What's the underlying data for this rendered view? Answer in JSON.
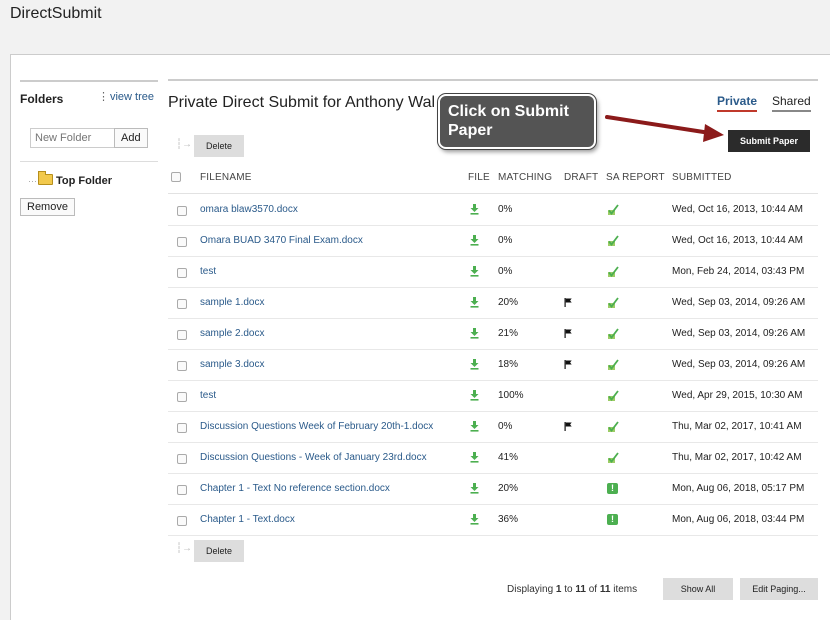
{
  "app": {
    "title": "DirectSubmit"
  },
  "sidebar": {
    "heading": "Folders",
    "view_tree": "view tree",
    "new_folder_placeholder": "New Folder",
    "add_label": "Add",
    "top_folder": "Top Folder",
    "remove_label": "Remove"
  },
  "main": {
    "title": "Private Direct Submit for Anthony Wal",
    "tabs": {
      "private": "Private",
      "shared": "Shared"
    },
    "submit_label": "Submit Paper",
    "delete_label": "Delete",
    "columns": {
      "filename": "FILENAME",
      "file": "FILE",
      "matching": "MATCHING",
      "draft": "DRAFT",
      "sa_report": "SA REPORT",
      "submitted": "SUBMITTED"
    },
    "rows": [
      {
        "filename": "omara blaw3570.docx",
        "matching": "0%",
        "draft": false,
        "sa": "ok",
        "submitted": "Wed, Oct 16, 2013, 10:44 AM"
      },
      {
        "filename": "Omara BUAD 3470 Final Exam.docx",
        "matching": "0%",
        "draft": false,
        "sa": "ok",
        "submitted": "Wed, Oct 16, 2013, 10:44 AM"
      },
      {
        "filename": "test",
        "matching": "0%",
        "draft": false,
        "sa": "ok",
        "submitted": "Mon, Feb 24, 2014, 03:43 PM"
      },
      {
        "filename": "sample 1.docx",
        "matching": "20%",
        "draft": true,
        "sa": "ok",
        "submitted": "Wed, Sep 03, 2014, 09:26 AM"
      },
      {
        "filename": "sample 2.docx",
        "matching": "21%",
        "draft": true,
        "sa": "ok",
        "submitted": "Wed, Sep 03, 2014, 09:26 AM"
      },
      {
        "filename": "sample 3.docx",
        "matching": "18%",
        "draft": true,
        "sa": "ok",
        "submitted": "Wed, Sep 03, 2014, 09:26 AM"
      },
      {
        "filename": "test",
        "matching": "100%",
        "draft": false,
        "sa": "ok",
        "submitted": "Wed, Apr 29, 2015, 10:30 AM"
      },
      {
        "filename": "Discussion Questions Week of February 20th-1.docx",
        "matching": "0%",
        "draft": true,
        "sa": "ok",
        "submitted": "Thu, Mar 02, 2017, 10:41 AM"
      },
      {
        "filename": "Discussion Questions - Week of January 23rd.docx",
        "matching": "41%",
        "draft": false,
        "sa": "ok",
        "submitted": "Thu, Mar 02, 2017, 10:42 AM"
      },
      {
        "filename": "Chapter 1 - Text No reference section.docx",
        "matching": "20%",
        "draft": false,
        "sa": "warn",
        "submitted": "Mon, Aug 06, 2018, 05:17 PM"
      },
      {
        "filename": "Chapter 1 - Text.docx",
        "matching": "36%",
        "draft": false,
        "sa": "warn",
        "submitted": "Mon, Aug 06, 2018, 03:44 PM"
      }
    ],
    "footer": {
      "prefix": "Displaying",
      "from": "1",
      "to_word": "to",
      "to": "11",
      "of_word": "of",
      "total": "11",
      "suffix": "items",
      "show_all": "Show All",
      "edit_paging": "Edit Paging..."
    }
  },
  "callout": {
    "text": "Click on Submit Paper"
  },
  "colors": {
    "link": "#2a5a8a",
    "accent": "#c0392b",
    "success": "#4caf50",
    "arrow": "#8b1a1a"
  },
  "icons": {
    "download": "download-icon",
    "draft": "flag-icon",
    "sa_ok": "check-report-icon",
    "sa_warn": "warning-icon"
  }
}
